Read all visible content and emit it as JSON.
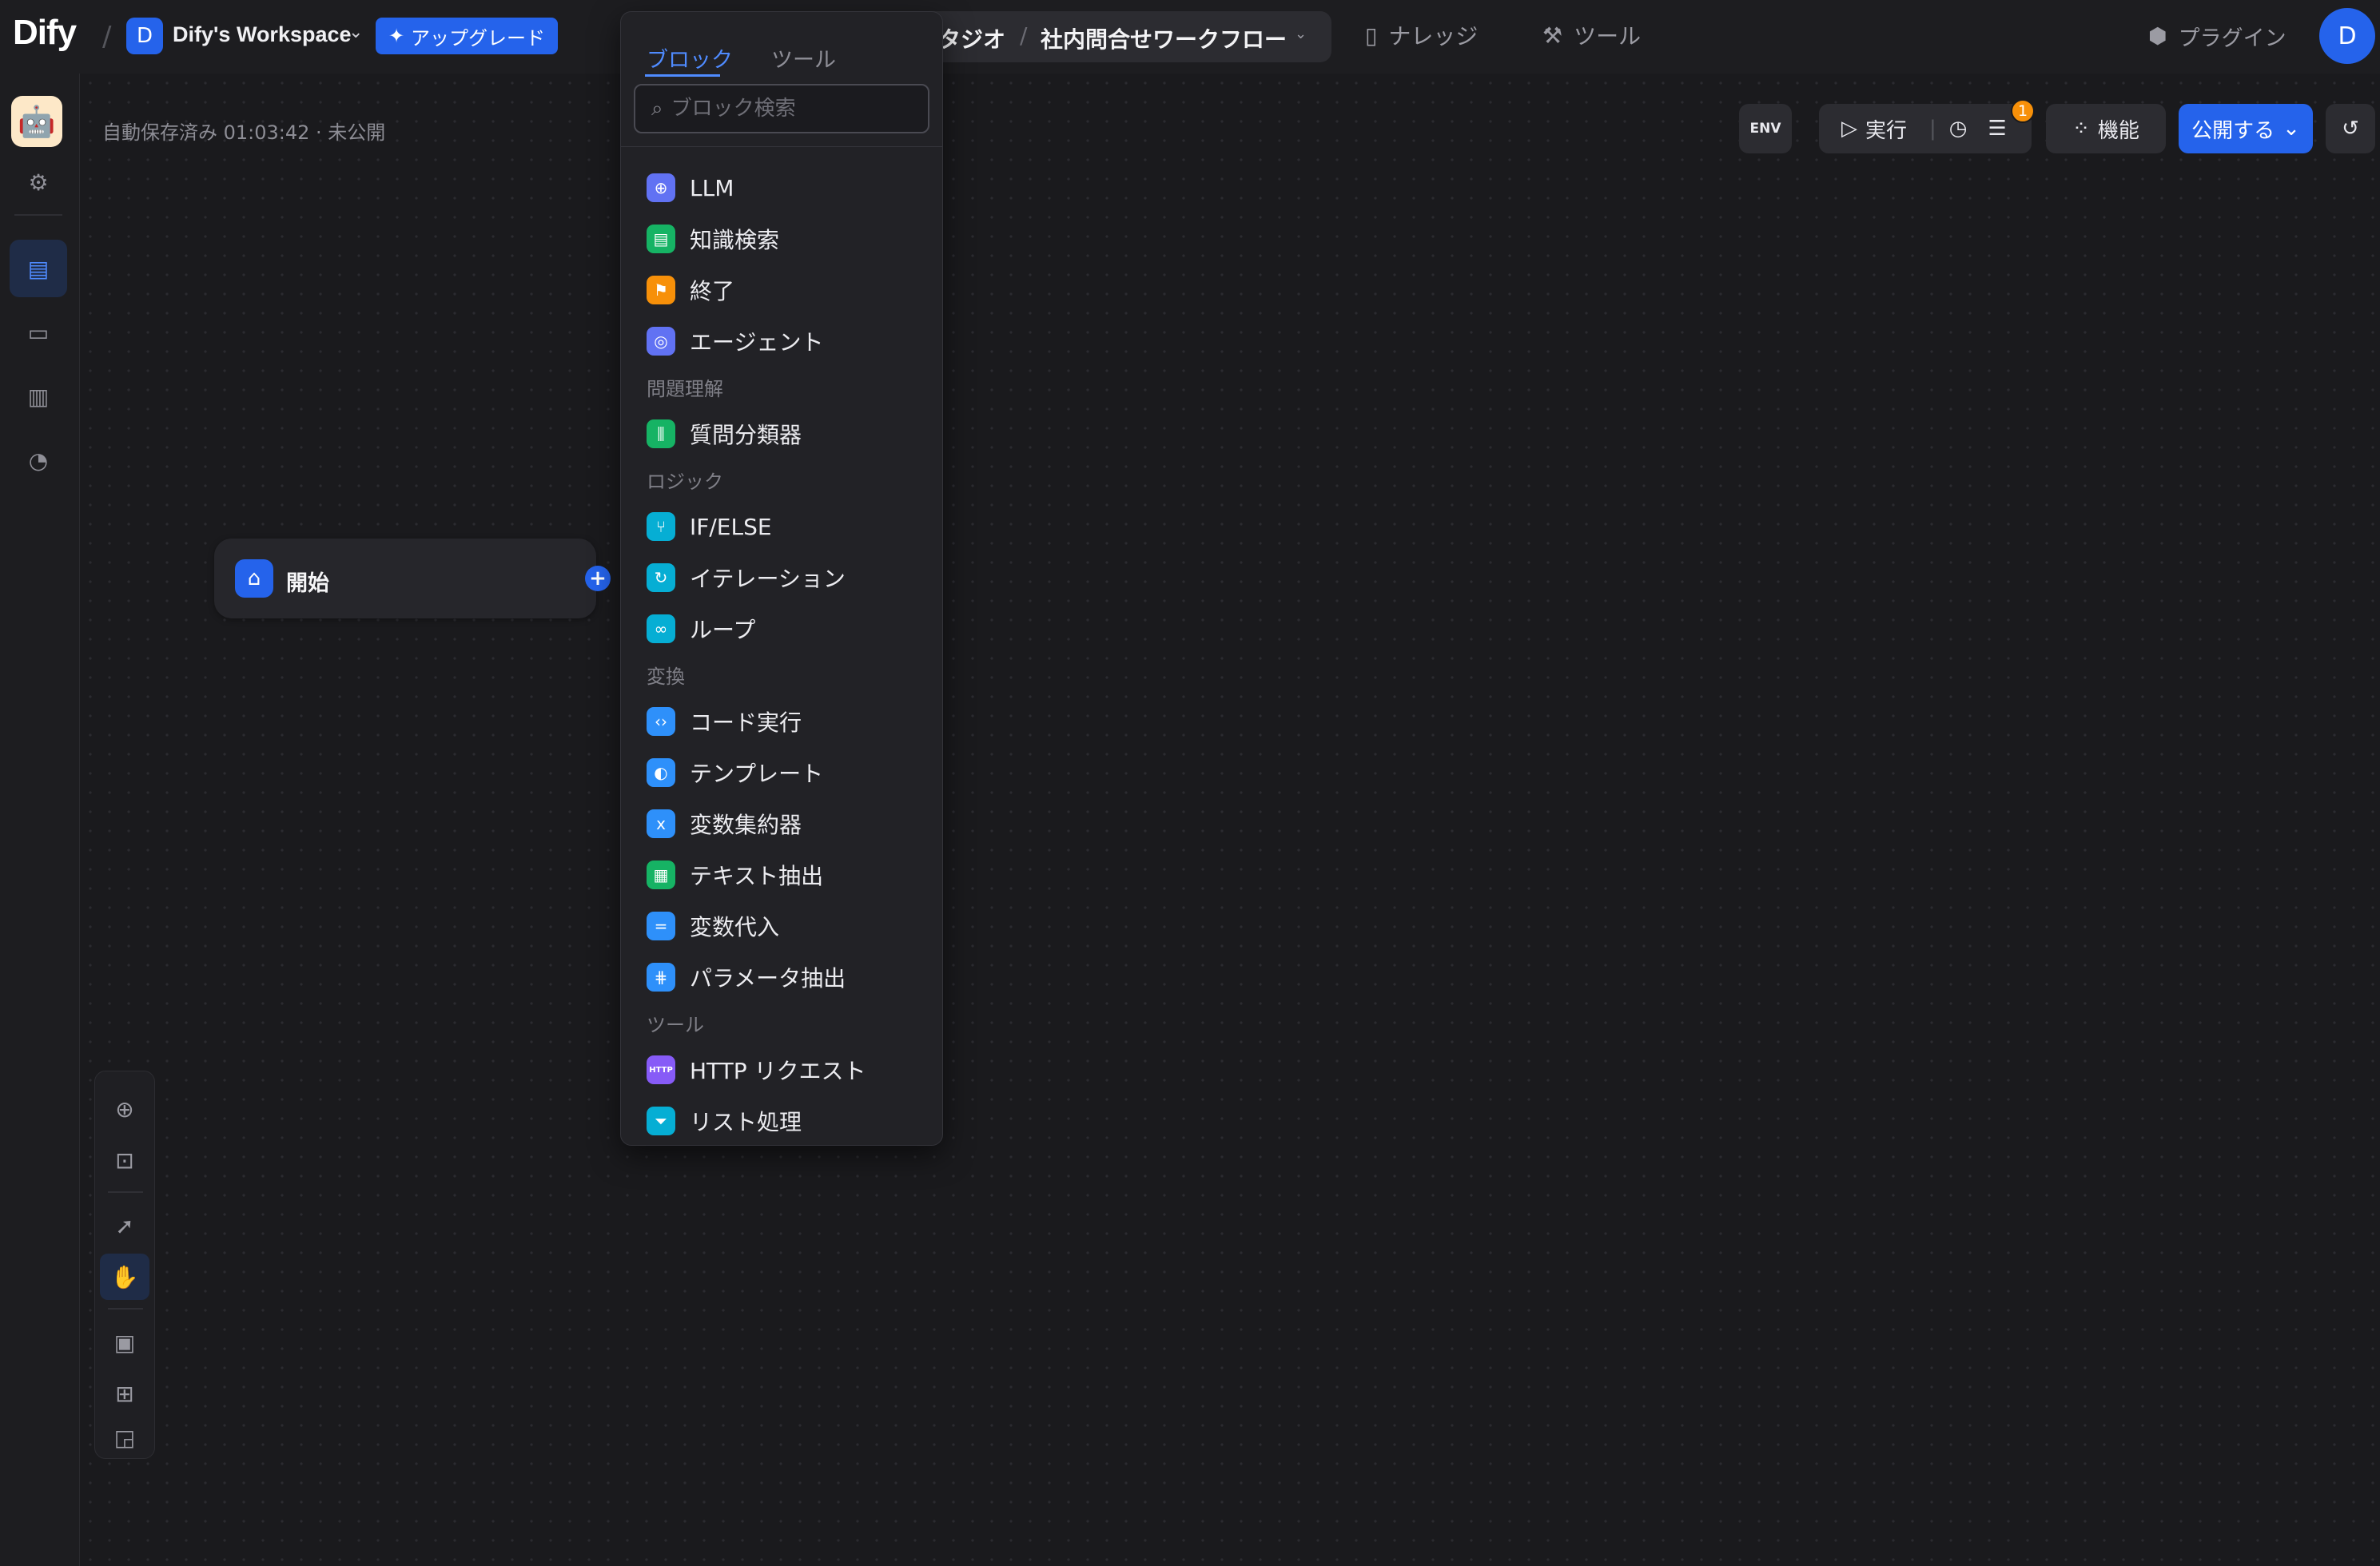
{
  "topbar": {
    "logo": "Dify",
    "workspace_initial": "D",
    "workspace_name": "Dify's Workspace",
    "upgrade_label": "アップグレード",
    "studio_label": "タジオ",
    "app_name": "社内問合せワークフロー",
    "nav": [
      {
        "label": "ナレッジ",
        "icon": "book-icon"
      },
      {
        "label": "ツール",
        "icon": "tool-icon"
      }
    ],
    "plugin_label": "プラグイン",
    "user_initial": "D"
  },
  "canvas": {
    "autosave_text": "自動保存済み 01:03:42 · 未公開",
    "run_label": "実行",
    "feature_label": "機能",
    "publish_label": "公開する",
    "env_label": "ENV",
    "checklist_badge": "1",
    "start_node_label": "開始"
  },
  "picker": {
    "tabs": [
      "ブロック",
      "ツール"
    ],
    "search_placeholder": "ブロック検索",
    "items_top": [
      {
        "label": "LLM",
        "icon": "llm-icon",
        "color": "#6172f3",
        "glyph": "⊕"
      },
      {
        "label": "知識検索",
        "icon": "knowledge-icon",
        "color": "#16b364",
        "glyph": "▤"
      },
      {
        "label": "終了",
        "icon": "end-icon",
        "color": "#f79009",
        "glyph": "⚑"
      },
      {
        "label": "エージェント",
        "icon": "agent-icon",
        "color": "#6172f3",
        "glyph": "◎"
      }
    ],
    "group_understanding": "問題理解",
    "items_understanding": [
      {
        "label": "質問分類器",
        "icon": "classifier-icon",
        "color": "#16b364",
        "glyph": "⫼"
      }
    ],
    "group_logic": "ロジック",
    "items_logic": [
      {
        "label": "IF/ELSE",
        "icon": "ifelse-icon",
        "color": "#06aed4",
        "glyph": "⑂"
      },
      {
        "label": "イテレーション",
        "icon": "iteration-icon",
        "color": "#06aed4",
        "glyph": "↻"
      },
      {
        "label": "ループ",
        "icon": "loop-icon",
        "color": "#06aed4",
        "glyph": "∞"
      }
    ],
    "group_transform": "変換",
    "items_transform": [
      {
        "label": "コード実行",
        "icon": "code-icon",
        "color": "#2e90fa",
        "glyph": "‹›"
      },
      {
        "label": "テンプレート",
        "icon": "template-icon",
        "color": "#2e90fa",
        "glyph": "◐"
      },
      {
        "label": "変数集約器",
        "icon": "aggregator-icon",
        "color": "#2e90fa",
        "glyph": "x"
      },
      {
        "label": "テキスト抽出",
        "icon": "text-extract-icon",
        "color": "#16b364",
        "glyph": "▦"
      },
      {
        "label": "変数代入",
        "icon": "assign-icon",
        "color": "#2e90fa",
        "glyph": "="
      },
      {
        "label": "パラメータ抽出",
        "icon": "param-extract-icon",
        "color": "#2e90fa",
        "glyph": "⋕"
      }
    ],
    "group_tools": "ツール",
    "items_tools": [
      {
        "label": "HTTP リクエスト",
        "icon": "http-icon",
        "color": "#875bf7",
        "glyph": "HTTP"
      },
      {
        "label": "リスト処理",
        "icon": "list-filter-icon",
        "color": "#06aed4",
        "glyph": "⏷"
      }
    ]
  }
}
